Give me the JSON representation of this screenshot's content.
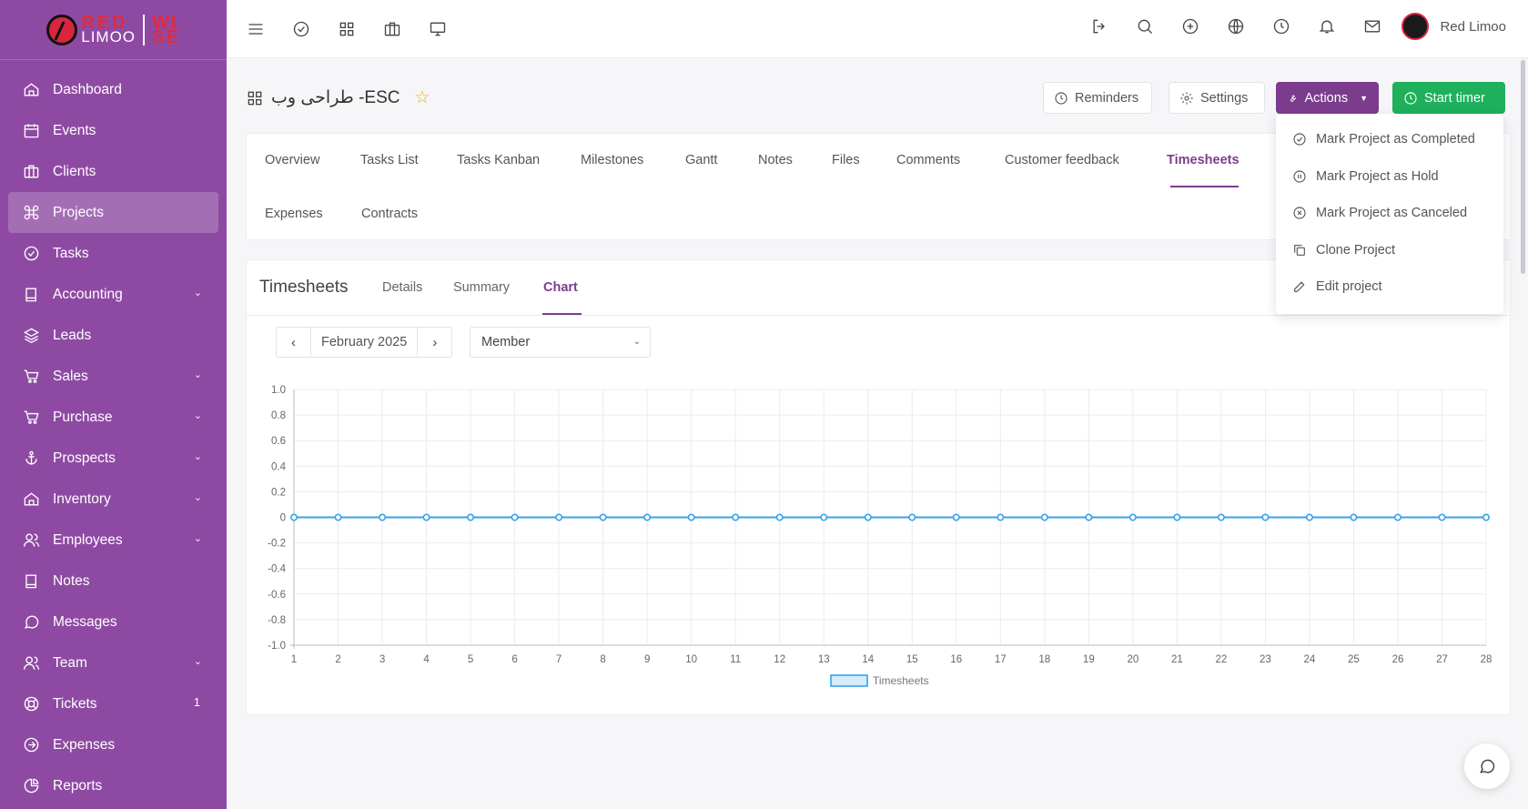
{
  "logo": {
    "red": "RED",
    "limoo": "LIMOO",
    "wise_top": "WI",
    "wise_bottom": "SE"
  },
  "sidebar": {
    "items": [
      {
        "label": "Dashboard",
        "icon": "home-icon",
        "chevron": false
      },
      {
        "label": "Events",
        "icon": "calendar-icon",
        "chevron": false
      },
      {
        "label": "Clients",
        "icon": "briefcase-icon",
        "chevron": false
      },
      {
        "label": "Projects",
        "icon": "command-icon",
        "chevron": false,
        "active": true
      },
      {
        "label": "Tasks",
        "icon": "check-circle-icon",
        "chevron": false
      },
      {
        "label": "Accounting",
        "icon": "book-icon",
        "chevron": true
      },
      {
        "label": "Leads",
        "icon": "layers-icon",
        "chevron": false
      },
      {
        "label": "Sales",
        "icon": "cart-icon",
        "chevron": true
      },
      {
        "label": "Purchase",
        "icon": "cart-icon",
        "chevron": true
      },
      {
        "label": "Prospects",
        "icon": "anchor-icon",
        "chevron": true
      },
      {
        "label": "Inventory",
        "icon": "home-icon",
        "chevron": true
      },
      {
        "label": "Employees",
        "icon": "users-icon",
        "chevron": true
      },
      {
        "label": "Notes",
        "icon": "book-icon",
        "chevron": false
      },
      {
        "label": "Messages",
        "icon": "message-icon",
        "chevron": false
      },
      {
        "label": "Team",
        "icon": "users-icon",
        "chevron": true
      },
      {
        "label": "Tickets",
        "icon": "lifebuoy-icon",
        "chevron": false,
        "badge": "1"
      },
      {
        "label": "Expenses",
        "icon": "arrow-circle-icon",
        "chevron": false
      },
      {
        "label": "Reports",
        "icon": "pie-chart-icon",
        "chevron": false
      }
    ]
  },
  "topbar": {
    "username": "Red Limoo"
  },
  "project": {
    "title": "طراحی وب -ESC"
  },
  "header_buttons": {
    "reminders": "Reminders",
    "settings": "Settings",
    "actions": "Actions",
    "start_timer": "Start timer"
  },
  "tabs": {
    "row1": [
      "Overview",
      "Tasks List",
      "Tasks Kanban",
      "Milestones",
      "Gantt",
      "Notes",
      "Files",
      "Comments",
      "Customer feedback",
      "Timesheets"
    ],
    "row2": [
      "Expenses",
      "Contracts"
    ],
    "active": "Timesheets"
  },
  "actions_menu": [
    {
      "label": "Mark Project as Completed",
      "icon": "check-circle-icon"
    },
    {
      "label": "Mark Project as Hold",
      "icon": "pause-circle-icon"
    },
    {
      "label": "Mark Project as Canceled",
      "icon": "x-circle-icon"
    },
    {
      "label": "Clone Project",
      "icon": "copy-icon"
    },
    {
      "label": "Edit project",
      "icon": "edit-icon"
    }
  ],
  "timesheets": {
    "title": "Timesheets",
    "subtabs": [
      "Details",
      "Summary",
      "Chart"
    ],
    "active_subtab": "Chart",
    "month": "February 2025",
    "member_placeholder": "Member"
  },
  "colors": {
    "sidebar": "#8e4aa3",
    "accent": "#7c3c8e",
    "timer": "#1fb05c",
    "series": "#36a2eb"
  },
  "chart_data": {
    "type": "line",
    "x": [
      1,
      2,
      3,
      4,
      5,
      6,
      7,
      8,
      9,
      10,
      11,
      12,
      13,
      14,
      15,
      16,
      17,
      18,
      19,
      20,
      21,
      22,
      23,
      24,
      25,
      26,
      27,
      28
    ],
    "series": [
      {
        "name": "Timesheets",
        "values": [
          0,
          0,
          0,
          0,
          0,
          0,
          0,
          0,
          0,
          0,
          0,
          0,
          0,
          0,
          0,
          0,
          0,
          0,
          0,
          0,
          0,
          0,
          0,
          0,
          0,
          0,
          0,
          0
        ]
      }
    ],
    "ylim": [
      -1.0,
      1.0
    ],
    "yticks": [
      "1.0",
      "0.8",
      "0.6",
      "0.4",
      "0.2",
      "0",
      "-0.2",
      "-0.4",
      "-0.6",
      "-0.8",
      "-1.0"
    ],
    "grid": true,
    "legend": "bottom"
  }
}
